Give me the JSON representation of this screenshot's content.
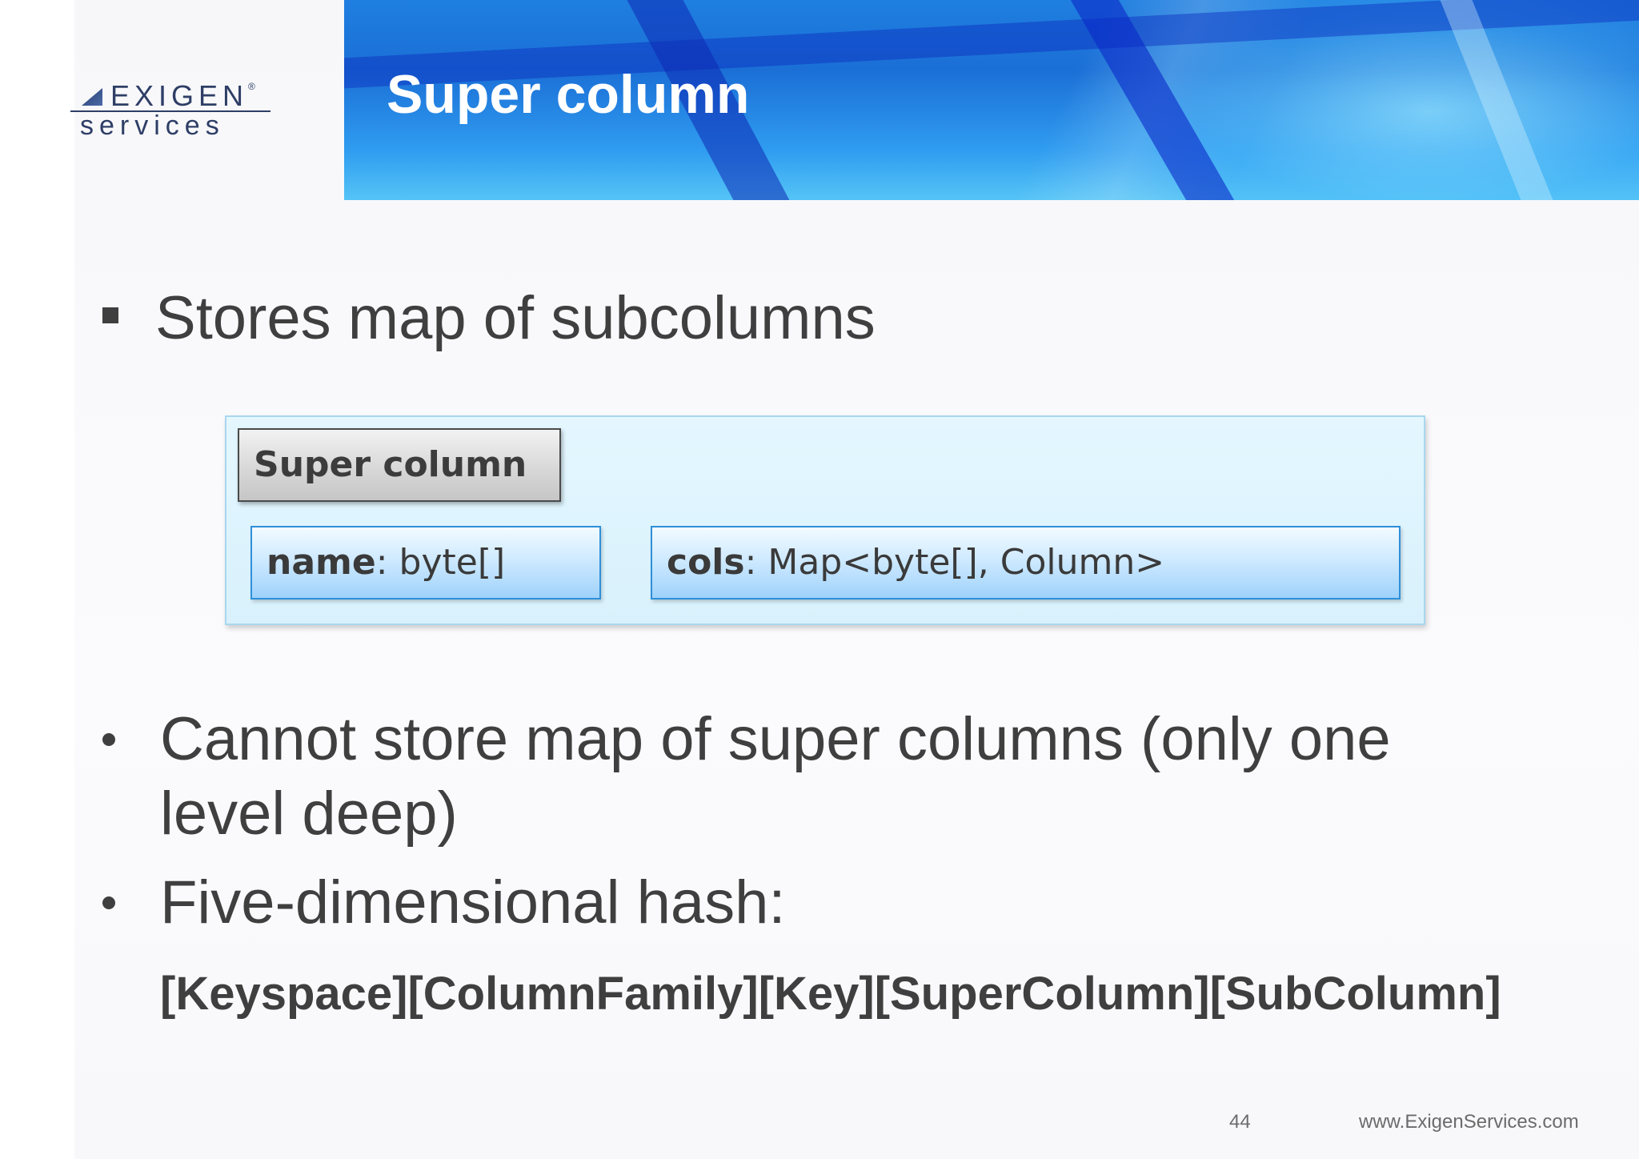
{
  "slide": {
    "title": "Super column",
    "logo": {
      "top_text": "EXIGEN",
      "bottom_text": "services",
      "registered": "®"
    },
    "bullets": [
      "Stores map of subcolumns",
      "Cannot store map of super columns (only one level deep)",
      "Five-dimensional hash:"
    ],
    "hash_expression": "[Keyspace][ColumnFamily][Key][SuperColumn][SubColumn]",
    "diagram": {
      "header": "Super column",
      "fields": [
        {
          "key": "name",
          "sep": ": ",
          "type": "byte[]"
        },
        {
          "key": "cols",
          "sep": ": ",
          "type": "Map<byte[], Column>"
        }
      ]
    },
    "footer": {
      "page_number": "44",
      "url": "www.ExigenServices.com"
    }
  },
  "colors": {
    "banner_blue": "#1b6fd6",
    "text_dark": "#3f3f3f",
    "diagram_bg": "#e4f7ff",
    "field_border": "#2f8fd8"
  },
  "icons": {
    "logo_mark": "exigen-logo-icon"
  }
}
